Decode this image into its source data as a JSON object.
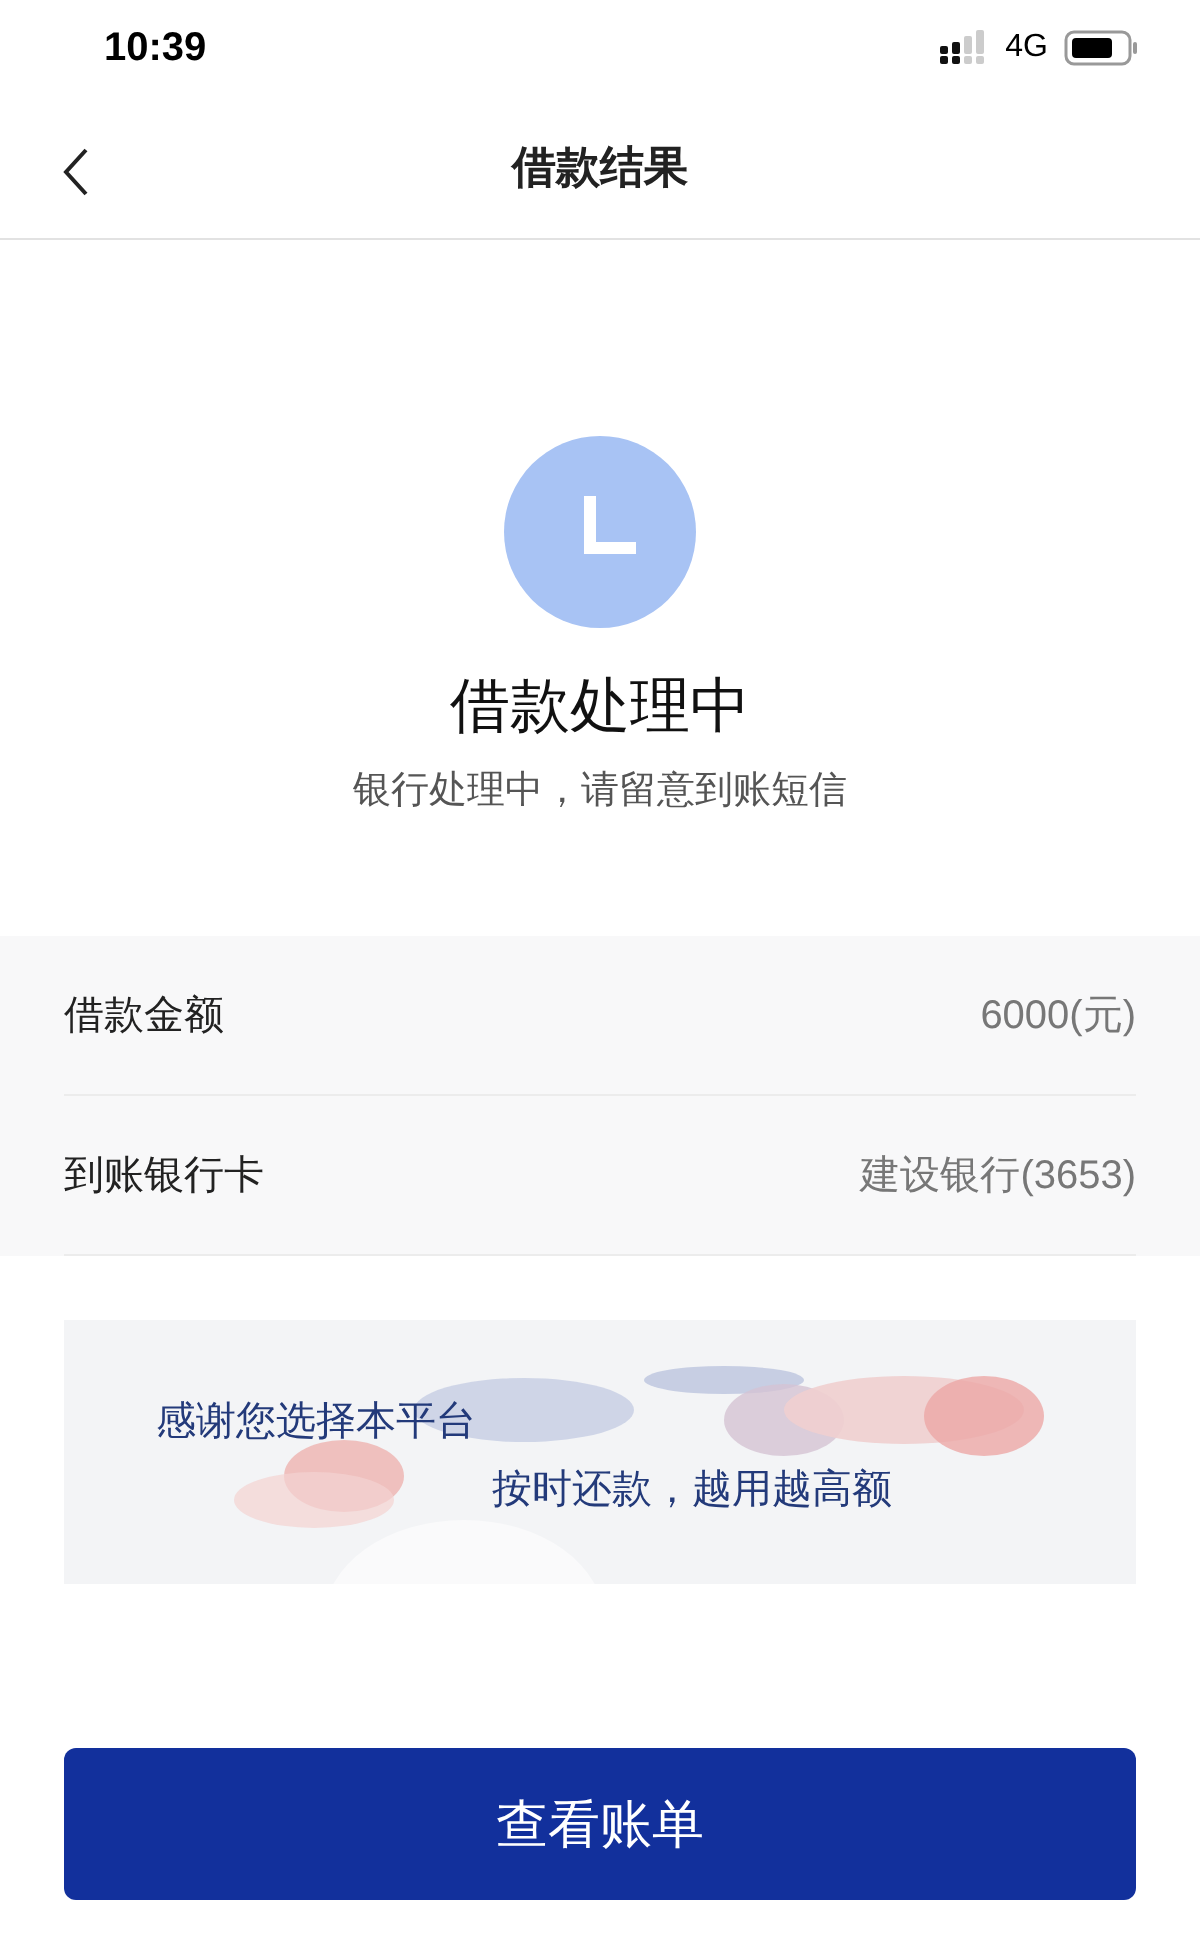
{
  "status_bar": {
    "time": "10:39",
    "network": "4G"
  },
  "nav": {
    "title": "借款结果"
  },
  "result": {
    "title": "借款处理中",
    "subtitle": "银行处理中，请留意到账短信"
  },
  "details": [
    {
      "label": "借款金额",
      "value": "6000(元)"
    },
    {
      "label": "到账银行卡",
      "value": "建设银行(3653)"
    }
  ],
  "banner": {
    "line_1": "感谢您选择本平台",
    "line_2": "按时还款，越用越高额"
  },
  "button": {
    "label": "查看账单"
  }
}
